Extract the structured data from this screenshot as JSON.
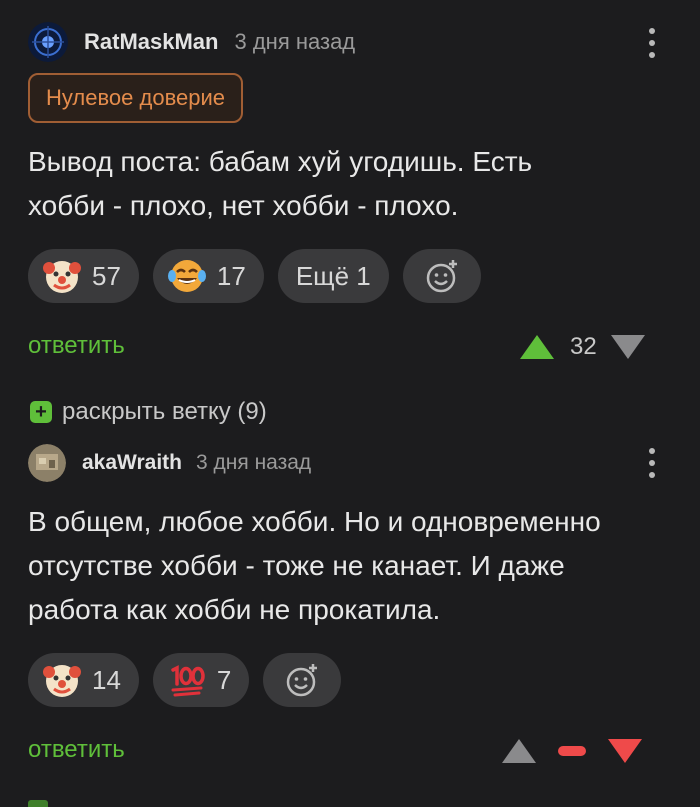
{
  "comment1": {
    "author": "RatMaskMan",
    "time": "3 дня назад",
    "badge": "Нулевое доверие",
    "text": "Вывод поста: бабам хуй угодишь. Есть\nхобби - плохо, нет хобби - плохо.",
    "reactions": [
      {
        "icon": "clown-face-icon",
        "count": "57"
      },
      {
        "icon": "laughing-tears-face-icon",
        "count": "17"
      }
    ],
    "more_reactions_label": "Ещё 1",
    "reply_label": "ответить",
    "score": "32"
  },
  "thread": {
    "expand_label": "раскрыть ветку (9)"
  },
  "comment2": {
    "author": "akaWraith",
    "time": "3 дня назад",
    "text": "В общем, любое хобби. Но и одновременно\nотсутстве хобби - тоже не канает. И даже\nработа как хобби не прокатила.",
    "reactions": [
      {
        "icon": "clown-face-icon",
        "count": "14"
      },
      {
        "icon": "hundred-points-icon",
        "count": "7"
      }
    ],
    "reply_label": "ответить"
  },
  "colors": {
    "background": "#1c1c1e",
    "accent_green": "#5fbf3a",
    "downvote_red": "#ef4a4a",
    "badge_orange": "#e48c4c",
    "pill_bg": "#3a3a3c"
  }
}
